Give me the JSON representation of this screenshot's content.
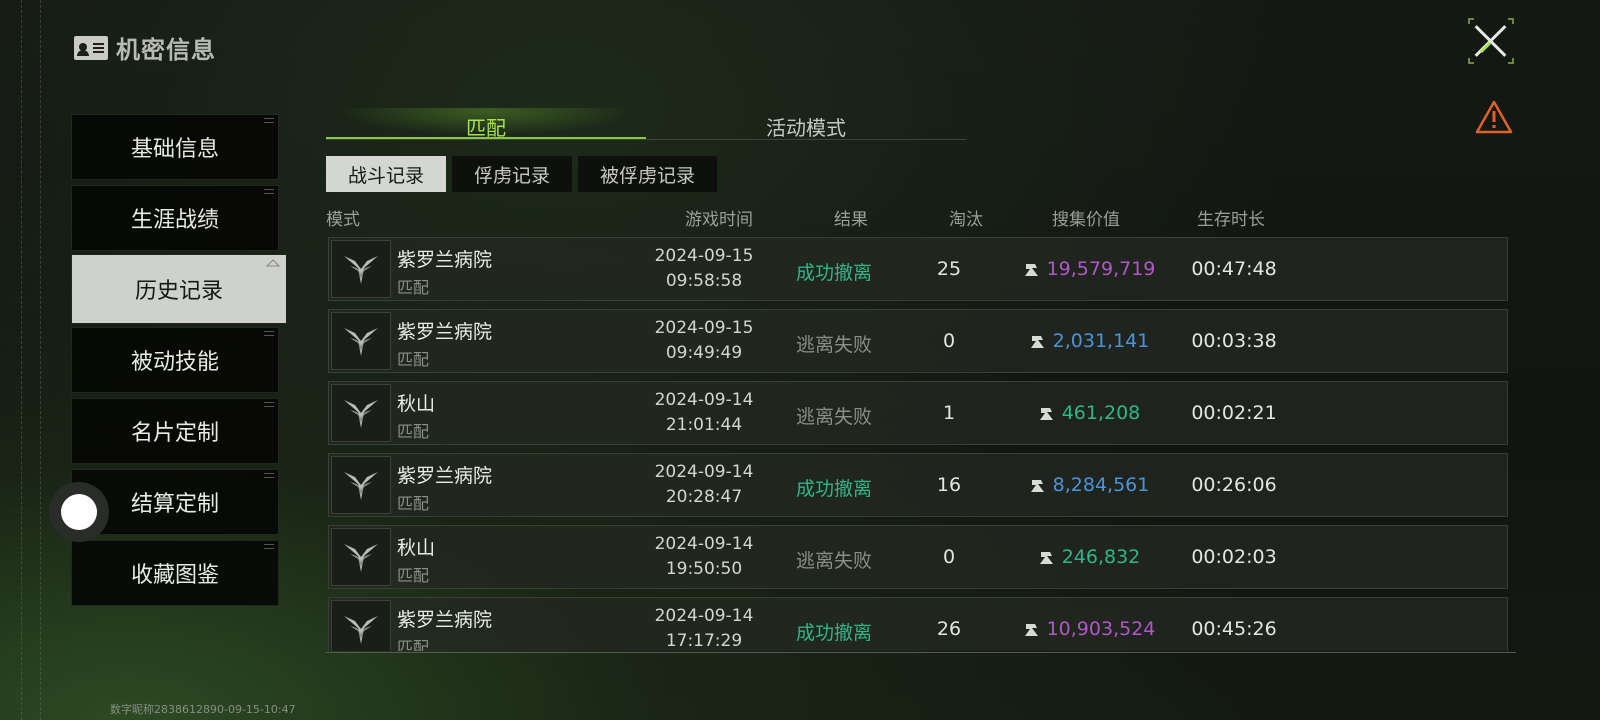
{
  "header": {
    "title": "机密信息",
    "icon": "id-card-icon"
  },
  "sidebar": {
    "items": [
      {
        "label": "基础信息"
      },
      {
        "label": "生涯战绩"
      },
      {
        "label": "历史记录",
        "active": true
      },
      {
        "label": "被动技能"
      },
      {
        "label": "名片定制"
      },
      {
        "label": "结算定制"
      },
      {
        "label": "收藏图鉴"
      }
    ]
  },
  "tabs": [
    {
      "label": "匹配",
      "active": true
    },
    {
      "label": "活动模式"
    }
  ],
  "subtabs": [
    {
      "label": "战斗记录",
      "active": true
    },
    {
      "label": "俘虏记录"
    },
    {
      "label": "被俘虏记录"
    }
  ],
  "columns": {
    "mode": "模式",
    "time": "游戏时间",
    "result": "结果",
    "kills": "淘汰",
    "value": "搜集价值",
    "duration": "生存时长"
  },
  "colors": {
    "success": "#2fb58c",
    "fail": "#8b8d87",
    "purple": "#b257c9",
    "blue": "#4a94d8",
    "green": "#2fb58c",
    "accent": "#a8e24a"
  },
  "rows": [
    {
      "map": "紫罗兰病院",
      "mode": "匹配",
      "date": "2024-09-15",
      "clock": "09:58:58",
      "result": "成功撤离",
      "kills": "25",
      "value": "19,579,719",
      "value_color": "purple",
      "duration": "00:47:48",
      "success": true
    },
    {
      "map": "紫罗兰病院",
      "mode": "匹配",
      "date": "2024-09-15",
      "clock": "09:49:49",
      "result": "逃离失败",
      "kills": "0",
      "value": "2,031,141",
      "value_color": "blue",
      "duration": "00:03:38",
      "success": false
    },
    {
      "map": "秋山",
      "mode": "匹配",
      "date": "2024-09-14",
      "clock": "21:01:44",
      "result": "逃离失败",
      "kills": "1",
      "value": "461,208",
      "value_color": "green",
      "duration": "00:02:21",
      "success": false
    },
    {
      "map": "紫罗兰病院",
      "mode": "匹配",
      "date": "2024-09-14",
      "clock": "20:28:47",
      "result": "成功撤离",
      "kills": "16",
      "value": "8,284,561",
      "value_color": "blue",
      "duration": "00:26:06",
      "success": true
    },
    {
      "map": "秋山",
      "mode": "匹配",
      "date": "2024-09-14",
      "clock": "19:50:50",
      "result": "逃离失败",
      "kills": "0",
      "value": "246,832",
      "value_color": "green",
      "duration": "00:02:03",
      "success": false
    },
    {
      "map": "紫罗兰病院",
      "mode": "匹配",
      "date": "2024-09-14",
      "clock": "17:17:29",
      "result": "成功撤离",
      "kills": "26",
      "value": "10,903,524",
      "value_color": "purple",
      "duration": "00:45:26",
      "success": true
    }
  ],
  "footer": {
    "watermark": "数字昵称2838612890-09-15-10:47"
  }
}
